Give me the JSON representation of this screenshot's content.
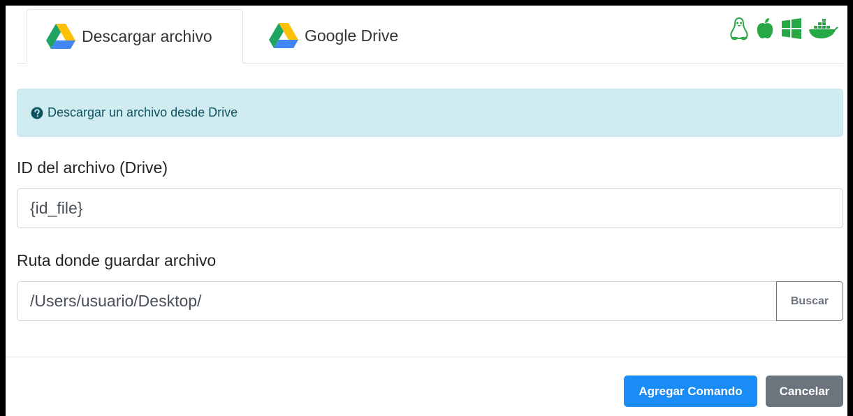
{
  "tabs": [
    {
      "label": "Descargar archivo",
      "icon": "google-drive-icon",
      "active": true
    },
    {
      "label": "Google Drive",
      "icon": "google-drive-icon",
      "active": false
    }
  ],
  "os_icons": [
    "linux-icon",
    "apple-icon",
    "windows-icon",
    "docker-icon"
  ],
  "os_icon_color": "#28a745",
  "alert": {
    "icon": "question-circle-icon",
    "text": "Descargar un archivo desde Drive"
  },
  "fields": {
    "id_label": "ID del archivo (Drive)",
    "id_value": "{id_file}",
    "ruta_label": "Ruta donde guardar archivo",
    "ruta_value": "/Users/usuario/Desktop/",
    "buscar_label": "Buscar"
  },
  "footer": {
    "add_label": "Agregar Comando",
    "cancel_label": "Cancelar"
  }
}
